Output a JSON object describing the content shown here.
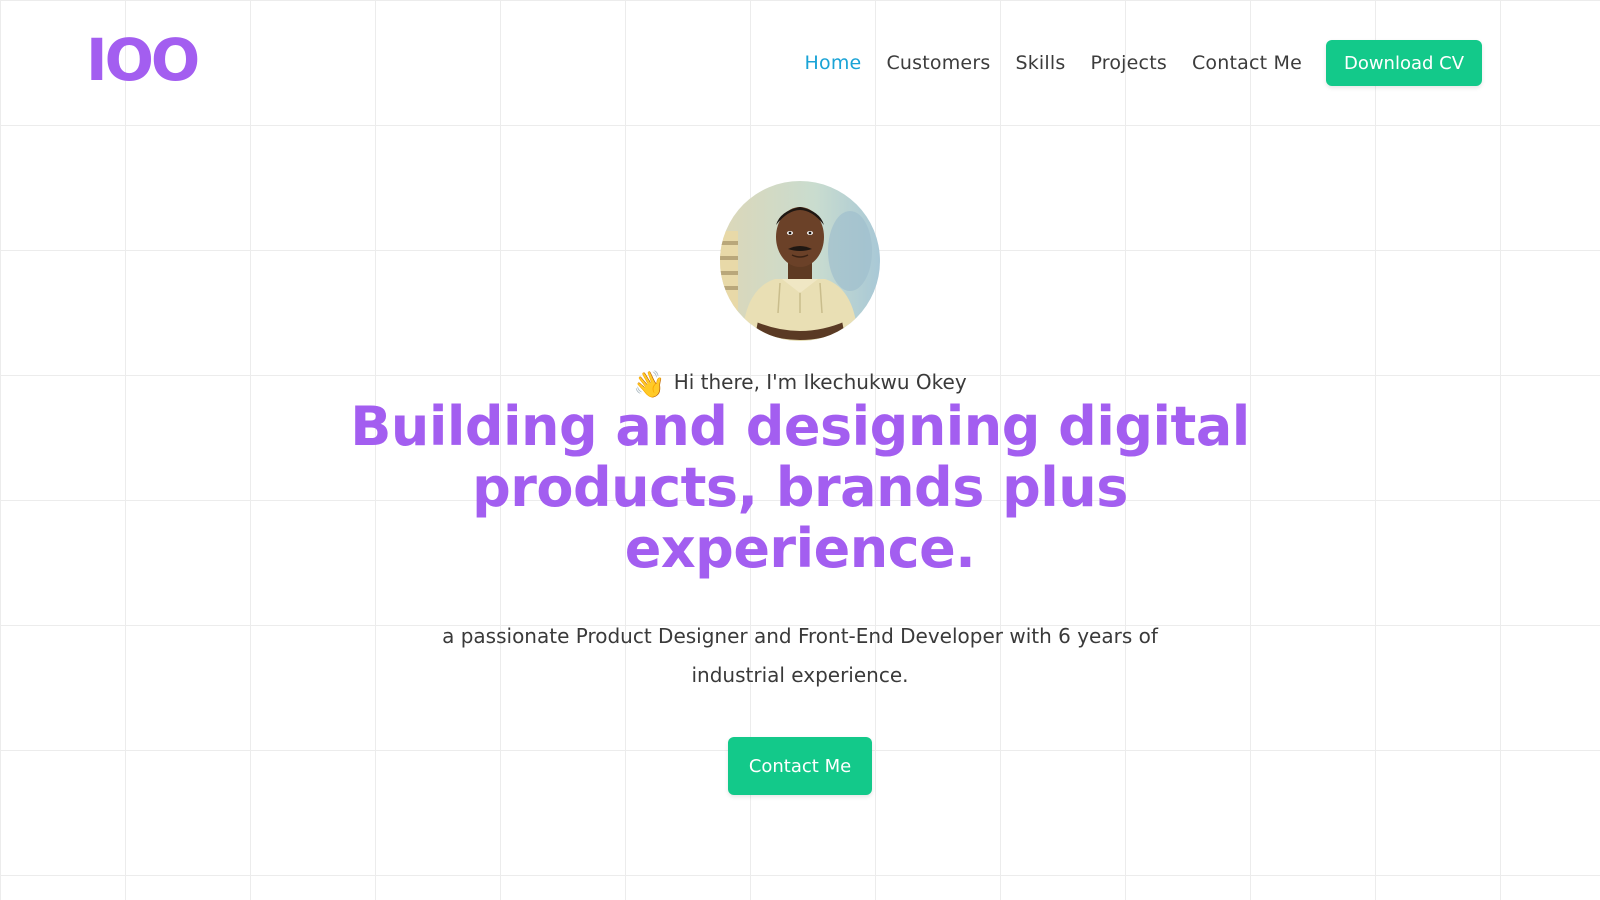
{
  "brand": {
    "logo_text": "IOO",
    "accent_color": "#a35ef0"
  },
  "nav": {
    "items": [
      {
        "label": "Home",
        "active": true
      },
      {
        "label": "Customers",
        "active": false
      },
      {
        "label": "Skills",
        "active": false
      },
      {
        "label": "Projects",
        "active": false
      },
      {
        "label": "Contact Me",
        "active": false
      }
    ],
    "active_color": "#1aa3d6",
    "download_label": "Download CV"
  },
  "hero": {
    "greeting_icon": "👋",
    "greeting": "Hi there, I'm Ikechukwu Okey",
    "headline": "Building and designing digital products, brands plus experience.",
    "subtitle": "a passionate Product Designer and Front-End Developer with 6 years of industrial experience.",
    "cta_label": "Contact Me"
  },
  "colors": {
    "button_green": "#13c98a",
    "headline_purple": "#a35ef0"
  }
}
